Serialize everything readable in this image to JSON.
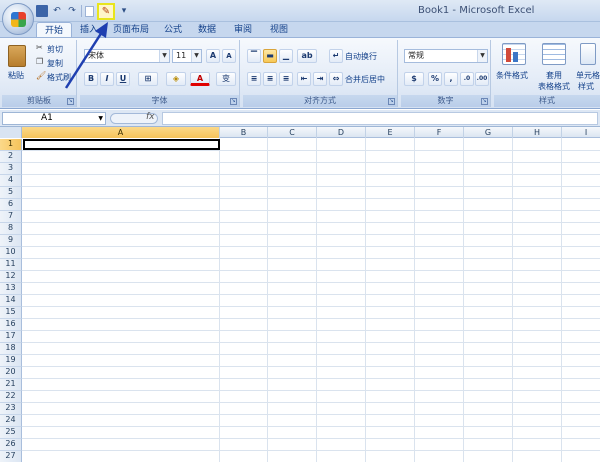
{
  "window": {
    "title": "Book1 - Microsoft Excel"
  },
  "qat": {
    "undo": "↶",
    "redo": "↷",
    "highlight_icon": "✎",
    "more": "▾"
  },
  "tabs": [
    {
      "label": "开始",
      "active": true
    },
    {
      "label": "插入",
      "active": false
    },
    {
      "label": "页面布局",
      "active": false
    },
    {
      "label": "公式",
      "active": false
    },
    {
      "label": "数据",
      "active": false
    },
    {
      "label": "审阅",
      "active": false
    },
    {
      "label": "视图",
      "active": false
    }
  ],
  "ribbon": {
    "clipboard": {
      "label": "剪贴板",
      "paste": "粘贴",
      "cut": "剪切",
      "copy": "复制",
      "format_painter": "格式刷"
    },
    "font": {
      "label": "字体",
      "font_name": "宋体",
      "font_size": "11",
      "bold": "B",
      "italic": "I",
      "underline": "U",
      "grow": "A",
      "shrink": "A",
      "color_a": "A",
      "phonetic": "变"
    },
    "alignment": {
      "label": "对齐方式",
      "wrap_text": "自动换行",
      "merge_center": "合并后居中"
    },
    "number": {
      "label": "数字",
      "format": "常规",
      "percent": "%",
      "comma": ","
    },
    "styles": {
      "label": "样式",
      "conditional": "条件格式",
      "table_format_1": "套用",
      "table_format_2": "表格格式",
      "cell_style_1": "单元格",
      "cell_style_2": "样式"
    }
  },
  "formula_bar": {
    "name_box": "A1",
    "fx": "fx"
  },
  "grid": {
    "columns": [
      "A",
      "B",
      "C",
      "D",
      "E",
      "F",
      "G",
      "H",
      "I"
    ],
    "rows": [
      "1",
      "2",
      "3",
      "4",
      "5",
      "6",
      "7",
      "8",
      "9",
      "10",
      "11",
      "12",
      "13",
      "14",
      "15",
      "16",
      "17",
      "18",
      "19",
      "20",
      "21",
      "22",
      "23",
      "24",
      "25",
      "26",
      "27"
    ],
    "selected_cell": "A1"
  },
  "colors": {
    "ribbon_blue": "#15428b",
    "highlight": "#e8e51c",
    "arrow": "#1f3fb0",
    "selected_header": "#f6c35a"
  }
}
